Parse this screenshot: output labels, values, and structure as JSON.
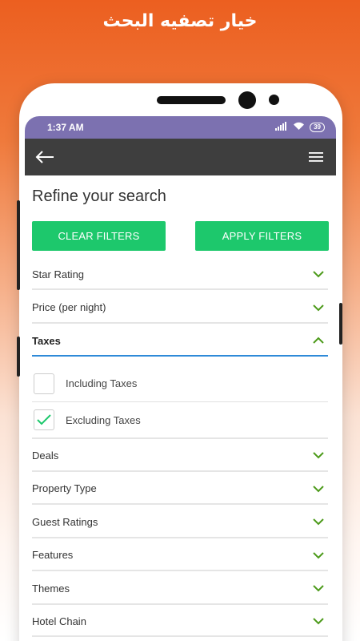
{
  "banner": {
    "title": "خيار تصفيه البحث"
  },
  "status_bar": {
    "time": "1:37 AM",
    "battery": "39"
  },
  "app_bar": {
    "back_icon": "back-arrow-icon",
    "menu_icon": "hamburger-menu-icon"
  },
  "page": {
    "title": "Refine your search",
    "clear_filters": "CLEAR FILTERS",
    "apply_filters": "APPLY FILTERS"
  },
  "colors": {
    "accent_green": "#1dc86c",
    "status_purple": "#7c71b0",
    "appbar_dark": "#3e3e3e",
    "chevron_green": "#4c9a1a",
    "active_underline": "#2e8ad8"
  },
  "filters": {
    "star_rating": "Star Rating",
    "price": "Price (per night)",
    "taxes": "Taxes",
    "including_taxes": "Including Taxes",
    "including_taxes_checked": false,
    "excluding_taxes": "Excluding Taxes",
    "excluding_taxes_checked": true,
    "deals": "Deals",
    "property_type": "Property Type",
    "guest_ratings": "Guest Ratings",
    "features": "Features",
    "themes": "Themes",
    "hotel_chain": "Hotel Chain"
  }
}
